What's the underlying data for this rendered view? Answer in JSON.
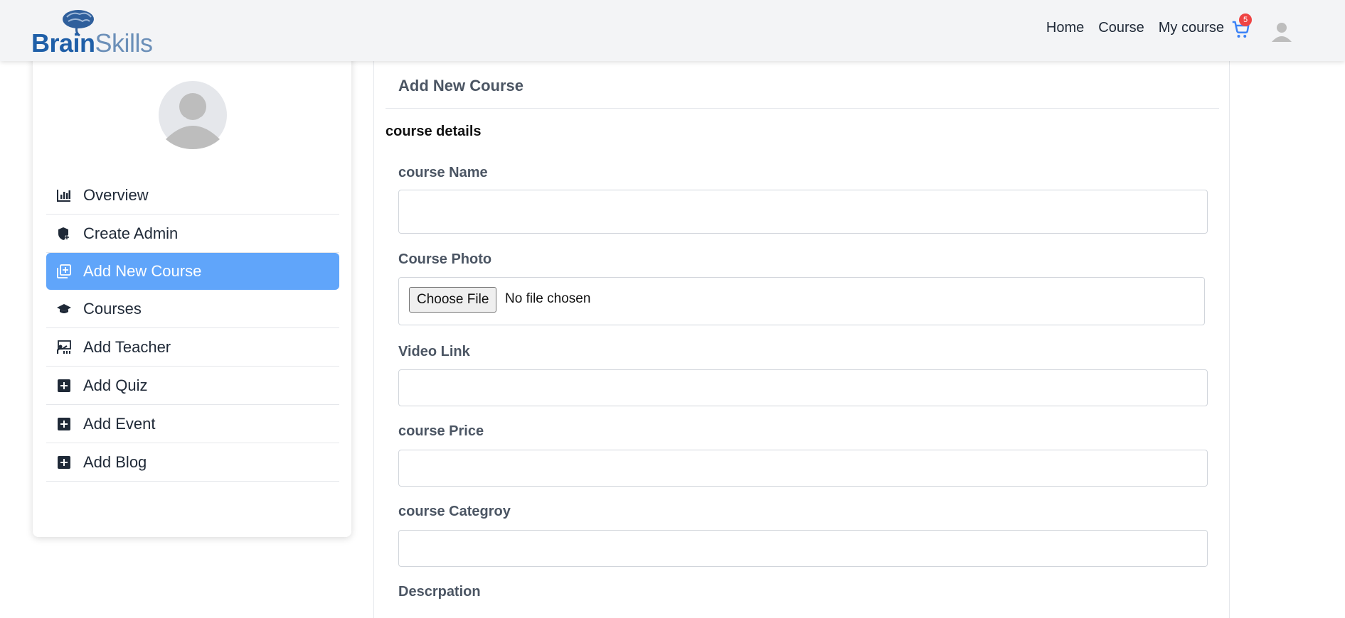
{
  "brand": {
    "name_part1": "Brain",
    "name_part2": "Skills"
  },
  "nav": {
    "links": [
      "Home",
      "Course",
      "My course"
    ],
    "cart_count": "5"
  },
  "sidebar": {
    "items": [
      {
        "label": "Overview",
        "icon": "chart-icon"
      },
      {
        "label": "Create Admin",
        "icon": "shield-plus-icon"
      },
      {
        "label": "Add New Course",
        "icon": "library-add-icon",
        "active": true
      },
      {
        "label": "Courses",
        "icon": "graduation-cap-icon"
      },
      {
        "label": "Add Teacher",
        "icon": "teacher-icon"
      },
      {
        "label": "Add Quiz",
        "icon": "plus-square-icon"
      },
      {
        "label": "Add Event",
        "icon": "plus-square-icon"
      },
      {
        "label": "Add Blog",
        "icon": "plus-square-icon"
      }
    ]
  },
  "form": {
    "title": "Add New Course",
    "section": "course details",
    "fields": {
      "name_label": "course Name",
      "photo_label": "Course Photo",
      "file_button": "Choose File",
      "file_status": "No file chosen",
      "video_label": "Video Link",
      "price_label": "course Price",
      "category_label": "course Categroy",
      "description_label": "Descrpation"
    }
  },
  "colors": {
    "accent": "#60a5fa",
    "brand_dark": "#1f5fa8",
    "brand_light": "#6b8fb8",
    "badge": "#ef4444"
  }
}
